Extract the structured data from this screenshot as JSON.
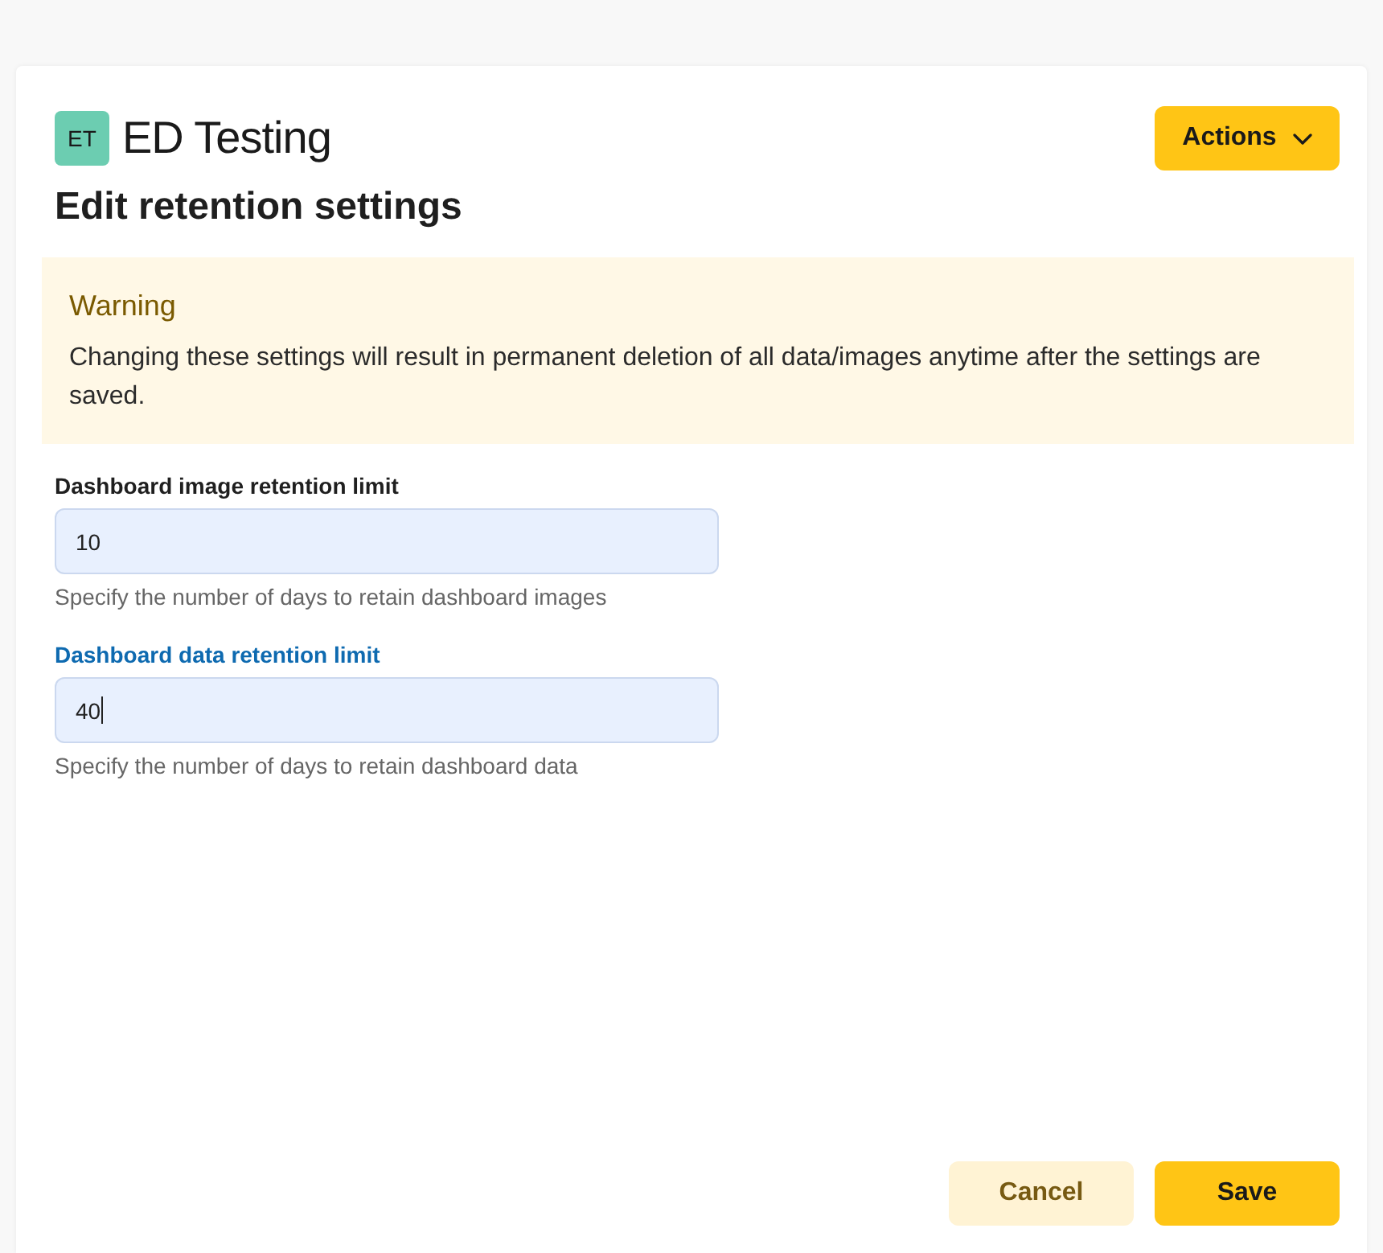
{
  "header": {
    "avatar_initials": "ET",
    "org_name": "ED Testing",
    "actions_button": "Actions"
  },
  "title": "Edit retention settings",
  "warning": {
    "title": "Warning",
    "message": "Changing these settings will result in permanent deletion of all data/images anytime after the settings are saved."
  },
  "fields": [
    {
      "label": "Dashboard image retention limit",
      "value": "10",
      "help": "Specify the number of days to retain dashboard images",
      "focused": false
    },
    {
      "label": "Dashboard data retention limit",
      "value": "40",
      "help": "Specify the number of days to retain dashboard data",
      "focused": true
    }
  ],
  "buttons": [
    {
      "label": "Cancel",
      "kind": "secondary"
    },
    {
      "label": "Save",
      "kind": "primary"
    }
  ]
}
